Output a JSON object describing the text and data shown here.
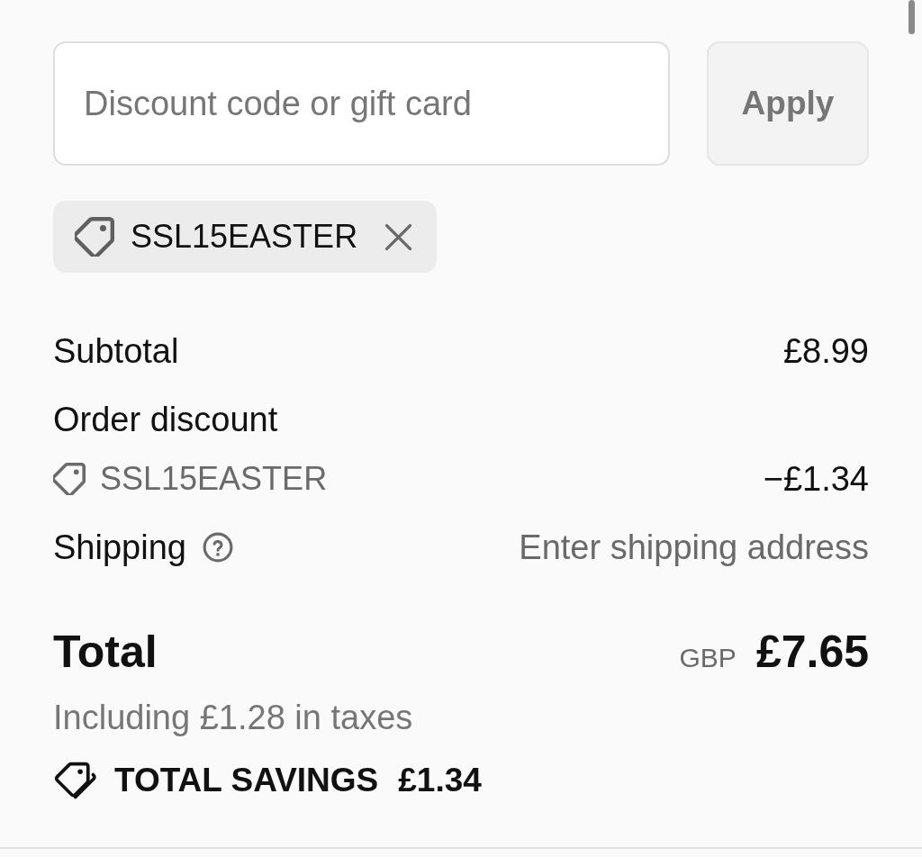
{
  "discount_form": {
    "placeholder": "Discount code or gift card",
    "apply_button": {
      "label": "Apply",
      "disabled": true
    }
  },
  "applied_codes": [
    {
      "code": "SSL15EASTER"
    }
  ],
  "summary_lines": [
    {
      "kind": "amount",
      "label": "Subtotal",
      "value": "£8.99"
    },
    {
      "kind": "discount",
      "label": "Order discount",
      "code": "SSL15EASTER",
      "value": "−£1.34"
    },
    {
      "kind": "help",
      "label": "Shipping",
      "value": "Enter shipping address"
    }
  ],
  "total": {
    "label": "Total",
    "currency": "GBP",
    "amount": "£7.65",
    "tax_note": "Including £1.28 in taxes"
  },
  "savings": {
    "label": "TOTAL SAVINGS",
    "amount": "£1.34"
  }
}
